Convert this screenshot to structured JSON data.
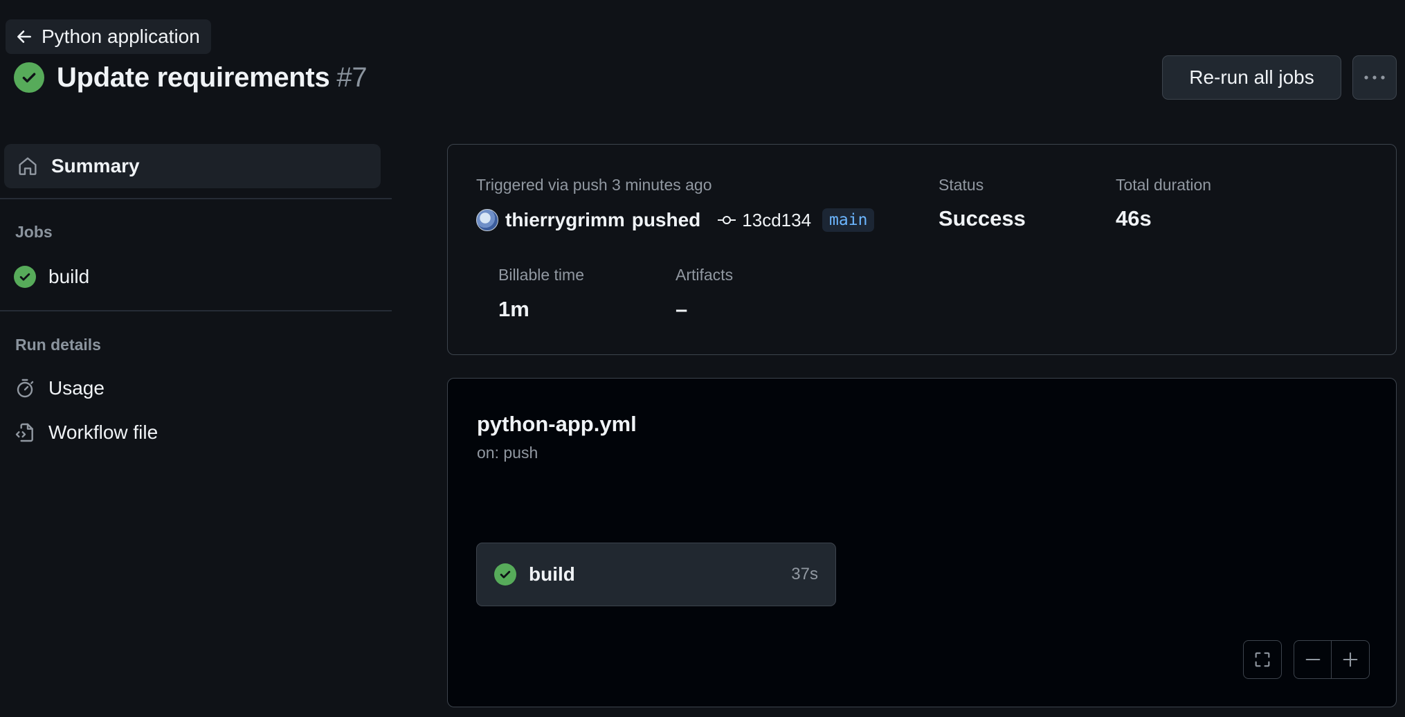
{
  "header": {
    "back_label": "Python application",
    "title": "Update requirements",
    "run_number": "#7",
    "rerun_label": "Re-run all jobs"
  },
  "sidebar": {
    "summary_label": "Summary",
    "jobs_heading": "Jobs",
    "jobs": [
      {
        "label": "build",
        "status": "success"
      }
    ],
    "run_details_heading": "Run details",
    "usage_label": "Usage",
    "workflow_file_label": "Workflow file"
  },
  "summary": {
    "trigger_text": "Triggered via push 3 minutes ago",
    "user": "thierrygrimm",
    "action": "pushed",
    "commit": "13cd134",
    "branch": "main",
    "status_label": "Status",
    "status_value": "Success",
    "duration_label": "Total duration",
    "duration_value": "46s",
    "billable_label": "Billable time",
    "billable_value": "1m",
    "artifacts_label": "Artifacts",
    "artifacts_value": "–"
  },
  "workflow": {
    "file_name": "python-app.yml",
    "trigger": "on: push",
    "job": {
      "name": "build",
      "duration": "37s",
      "status": "success"
    }
  },
  "colors": {
    "success": "#57ab5a",
    "background": "#0f1217",
    "branch_text": "#6cb6ff"
  }
}
